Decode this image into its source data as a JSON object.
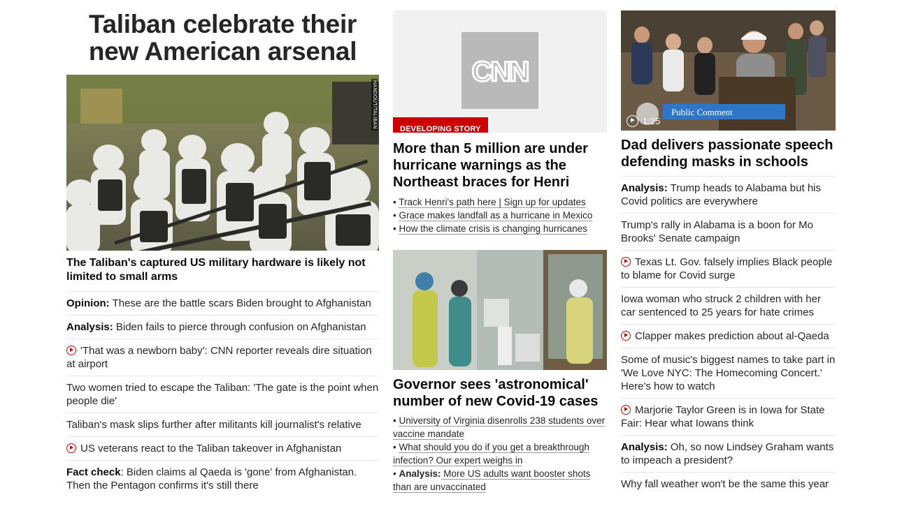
{
  "col1": {
    "headline": "Taliban celebrate their new American arsenal",
    "image_credit": "HANDOUT/TALIBAN",
    "lead_caption": "The Taliban's captured US military hardware is likely not limited to small arms",
    "items": [
      {
        "prefix": "Opinion:",
        "text": " These are the battle scars Biden brought to Afghanistan",
        "video": false
      },
      {
        "prefix": "Analysis:",
        "text": " Biden fails to pierce through confusion on Afghanistan",
        "video": false
      },
      {
        "prefix": "",
        "text": "'That was a newborn baby': CNN reporter reveals dire situation at airport",
        "video": true
      },
      {
        "prefix": "",
        "text": "Two women tried to escape the Taliban: 'The gate is the point when people die'",
        "video": false
      },
      {
        "prefix": "",
        "text": "Taliban's mask slips further after militants kill journalist's relative",
        "video": false
      },
      {
        "prefix": "",
        "text": "US veterans react to the Taliban takeover in Afghanistan",
        "video": true
      },
      {
        "prefix": "Fact check",
        "text": ": Biden claims al Qaeda is 'gone' from Afghanistan. Then the Pentagon confirms it's still there",
        "video": false
      }
    ]
  },
  "col2": {
    "logo_text": "CNN",
    "badge": "DEVELOPING STORY",
    "story1": {
      "headline": "More than 5 million are under hurricane warnings as the Northeast braces for Henri",
      "links": [
        {
          "text": "Track Henri's path here | Sign up for updates"
        },
        {
          "text": "Grace makes landfall as a hurricane in Mexico"
        },
        {
          "text": "How the climate crisis is changing hurricanes"
        }
      ]
    },
    "story2": {
      "headline": "Governor sees 'astronomical' number of new Covid-19 cases",
      "links": [
        {
          "prefix": "",
          "text": "University of Virginia disenrolls 238 students over vaccine mandate"
        },
        {
          "prefix": "",
          "text": "What should you do if you get a breakthrough infection? Our expert weighs in"
        },
        {
          "prefix": "Analysis:",
          "text": " More US adults want booster shots than are unvaccinated"
        }
      ]
    }
  },
  "col3": {
    "video_duration": "1:25",
    "video_overlay": "Public Comment",
    "headline": "Dad delivers passionate speech defending masks in schools",
    "items": [
      {
        "prefix": "Analysis:",
        "text": " Trump heads to Alabama but his Covid politics are everywhere",
        "video": false
      },
      {
        "prefix": "",
        "text": "Trump's rally in Alabama is a boon for Mo Brooks' Senate campaign",
        "video": false
      },
      {
        "prefix": "",
        "text": "Texas Lt. Gov. falsely implies Black people to blame for Covid surge",
        "video": true
      },
      {
        "prefix": "",
        "text": "Iowa woman who struck 2 children with her car sentenced to 25 years for hate crimes",
        "video": false
      },
      {
        "prefix": "",
        "text": "Clapper makes prediction about al-Qaeda",
        "video": true
      },
      {
        "prefix": "",
        "text": "Some of music's biggest names to take part in 'We Love NYC: The Homecoming Concert.' Here's how to watch",
        "video": false
      },
      {
        "prefix": "",
        "text": "Marjorie Taylor Green is in Iowa for State Fair: Hear what Iowans think",
        "video": true
      },
      {
        "prefix": "Analysis:",
        "text": " Oh, so now Lindsey Graham wants to impeach a president?",
        "video": false
      },
      {
        "prefix": "",
        "text": "Why fall weather won't be the same this year",
        "video": false
      }
    ]
  },
  "colors": {
    "accent": "#cc0000",
    "text": "#262626",
    "divider": "#e6e6e6"
  }
}
